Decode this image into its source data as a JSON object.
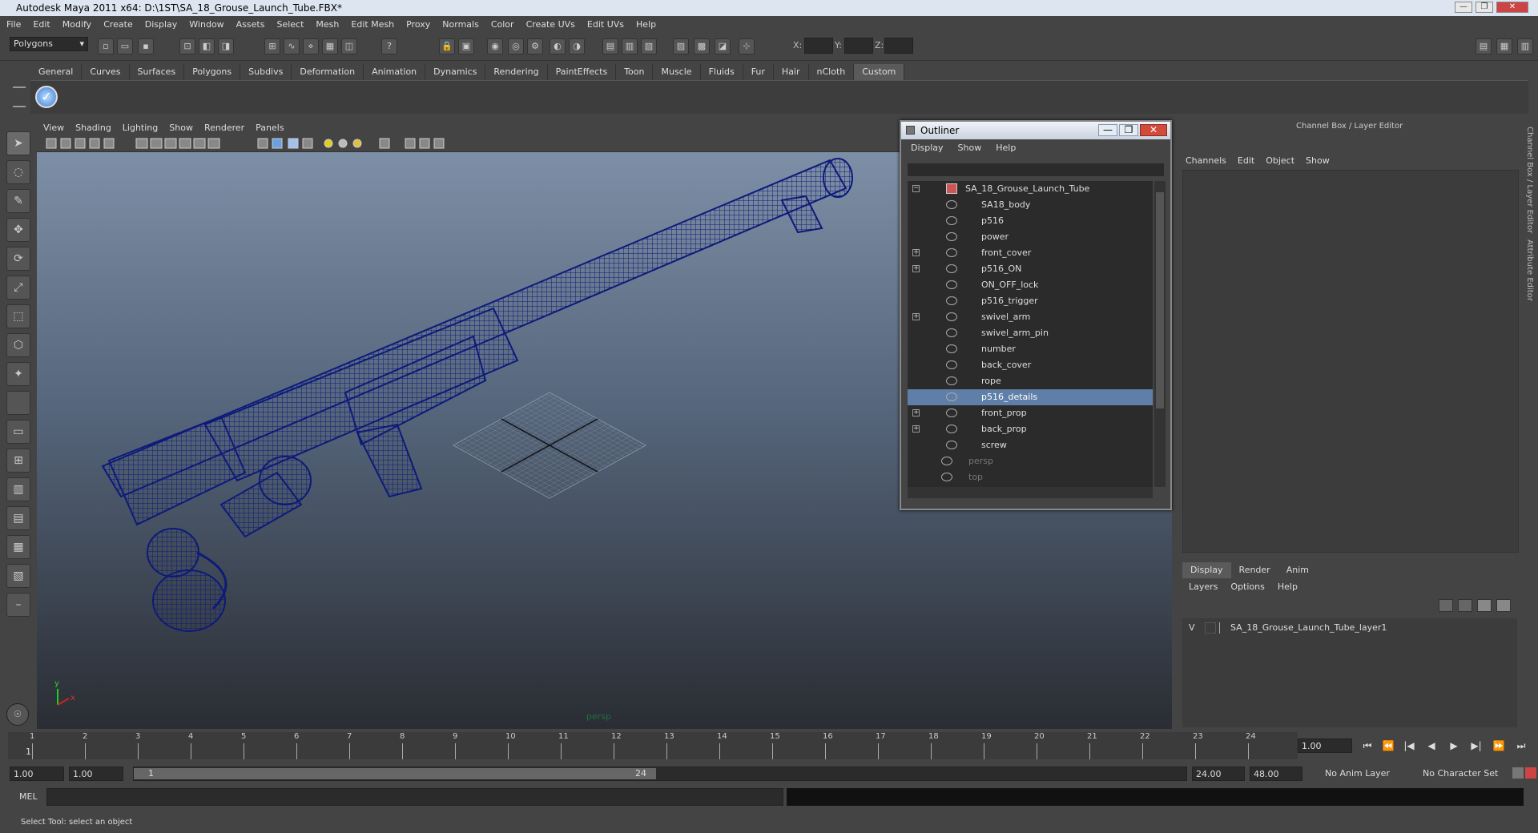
{
  "window": {
    "title": "Autodesk Maya 2011 x64: D:\\1ST\\SA_18_Grouse_Launch_Tube.FBX*",
    "btn_min": "—",
    "btn_max": "❐",
    "btn_close": "✕"
  },
  "menubar": [
    "File",
    "Edit",
    "Modify",
    "Create",
    "Display",
    "Window",
    "Assets",
    "Select",
    "Mesh",
    "Edit Mesh",
    "Proxy",
    "Normals",
    "Color",
    "Create UVs",
    "Edit UVs",
    "Help"
  ],
  "status": {
    "mode": "Polygons",
    "x_label": "X:",
    "y_label": "Y:",
    "z_label": "Z:"
  },
  "shelf_tabs": [
    "General",
    "Curves",
    "Surfaces",
    "Polygons",
    "Subdivs",
    "Deformation",
    "Animation",
    "Dynamics",
    "Rendering",
    "PaintEffects",
    "Toon",
    "Muscle",
    "Fluids",
    "Fur",
    "Hair",
    "nCloth",
    "Custom"
  ],
  "viewport": {
    "menu": [
      "View",
      "Shading",
      "Lighting",
      "Show",
      "Renderer",
      "Panels"
    ],
    "camera_label": "persp",
    "axis_y": "y",
    "axis_x": "x"
  },
  "outliner": {
    "title": "Outliner",
    "menu": [
      "Display",
      "Show",
      "Help"
    ],
    "root": "SA_18_Grouse_Launch_Tube",
    "items": [
      {
        "label": "SA18_body",
        "expand": ""
      },
      {
        "label": "p516",
        "expand": ""
      },
      {
        "label": "power",
        "expand": ""
      },
      {
        "label": "front_cover",
        "expand": "+"
      },
      {
        "label": "p516_ON",
        "expand": "+"
      },
      {
        "label": "ON_OFF_lock",
        "expand": ""
      },
      {
        "label": "p516_trigger",
        "expand": ""
      },
      {
        "label": "swivel_arm",
        "expand": "+"
      },
      {
        "label": "swivel_arm_pin",
        "expand": ""
      },
      {
        "label": "number",
        "expand": ""
      },
      {
        "label": "back_cover",
        "expand": ""
      },
      {
        "label": "rope",
        "expand": ""
      },
      {
        "label": "p516_details",
        "expand": "",
        "selected": true
      },
      {
        "label": "front_prop",
        "expand": "+"
      },
      {
        "label": "back_prop",
        "expand": "+"
      },
      {
        "label": "screw",
        "expand": ""
      }
    ],
    "cameras": [
      "persp",
      "top"
    ]
  },
  "channel_box": {
    "title": "Channel Box / Layer Editor",
    "menu": [
      "Channels",
      "Edit",
      "Object",
      "Show"
    ]
  },
  "side_tabs": [
    "Channel Box / Layer Editor",
    "Attribute Editor"
  ],
  "layer_editor": {
    "tabs": [
      "Display",
      "Render",
      "Anim"
    ],
    "menu": [
      "Layers",
      "Options",
      "Help"
    ],
    "layer": {
      "visible": "V",
      "name": "SA_18_Grouse_Launch_Tube_layer1"
    }
  },
  "timeline": {
    "ticks": [
      "1",
      "2",
      "3",
      "4",
      "5",
      "6",
      "7",
      "8",
      "9",
      "10",
      "11",
      "12",
      "13",
      "14",
      "15",
      "16",
      "17",
      "18",
      "19",
      "20",
      "21",
      "22",
      "23",
      "24"
    ],
    "current_frame": "1",
    "current_time": "1.00",
    "range_start": "1.00",
    "range_start2": "1.00",
    "slider_start": "1",
    "slider_end": "24",
    "end_time": "24.00",
    "end_time2": "48.00",
    "anim_layer": "No Anim Layer",
    "char_set": "No Character Set"
  },
  "command": {
    "label": "MEL"
  },
  "help_line": "Select Tool: select an object",
  "colors": {
    "wire": "#0d1a7a",
    "selection": "#5f7fa8",
    "bg_top": "#7d8fa6",
    "bg_bottom": "#2a2d33"
  }
}
